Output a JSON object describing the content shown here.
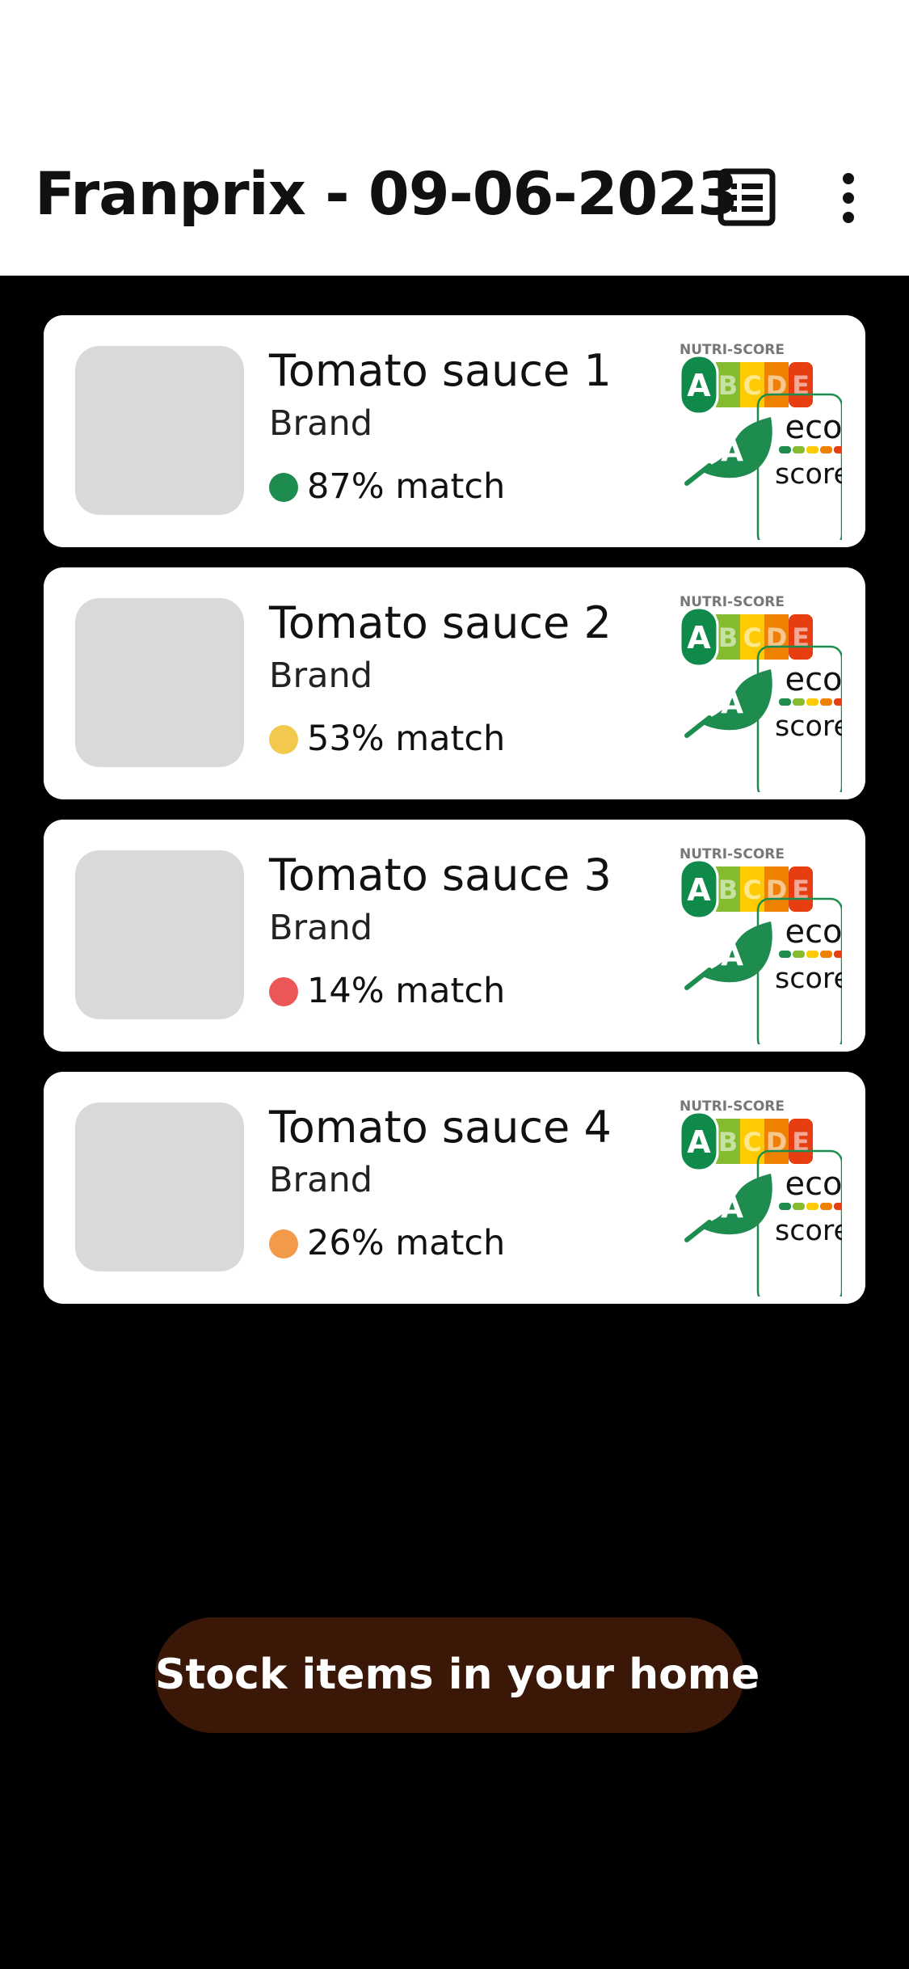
{
  "header": {
    "title": "Franprix - 09-06-2023",
    "list_icon": "list-icon",
    "menu_icon": "more-vertical-icon"
  },
  "products": [
    {
      "name": "Tomato sauce 1",
      "brand": "Brand",
      "match": "87% match",
      "match_color": "#1e8c4e",
      "nutri_label": "NUTRI-SCORE",
      "nutri_grades": [
        "A",
        "B",
        "C",
        "D",
        "E"
      ],
      "eco_grade": "A",
      "eco_words": [
        "eco",
        "score"
      ]
    },
    {
      "name": "Tomato sauce 2",
      "brand": "Brand",
      "match": "53% match",
      "match_color": "#f2c94c",
      "nutri_label": "NUTRI-SCORE",
      "nutri_grades": [
        "A",
        "B",
        "C",
        "D",
        "E"
      ],
      "eco_grade": "A",
      "eco_words": [
        "eco",
        "score"
      ]
    },
    {
      "name": "Tomato sauce 3",
      "brand": "Brand",
      "match": "14% match",
      "match_color": "#eb5757",
      "nutri_label": "NUTRI-SCORE",
      "nutri_grades": [
        "A",
        "B",
        "C",
        "D",
        "E"
      ],
      "eco_grade": "A",
      "eco_words": [
        "eco",
        "score"
      ]
    },
    {
      "name": "Tomato sauce 4",
      "brand": "Brand",
      "match": "26% match",
      "match_color": "#f2994a",
      "nutri_label": "NUTRI-SCORE",
      "nutri_grades": [
        "A",
        "B",
        "C",
        "D",
        "E"
      ],
      "eco_grade": "A",
      "eco_words": [
        "eco",
        "score"
      ]
    }
  ],
  "cta": {
    "label": "Stock items in your home"
  },
  "colors": {
    "nutri": [
      "#0f8a4a",
      "#85bb2f",
      "#fecb02",
      "#ee8100",
      "#e63e11"
    ],
    "eco_leaf": "#1e8c4e",
    "cta_bg": "#3a1707"
  }
}
